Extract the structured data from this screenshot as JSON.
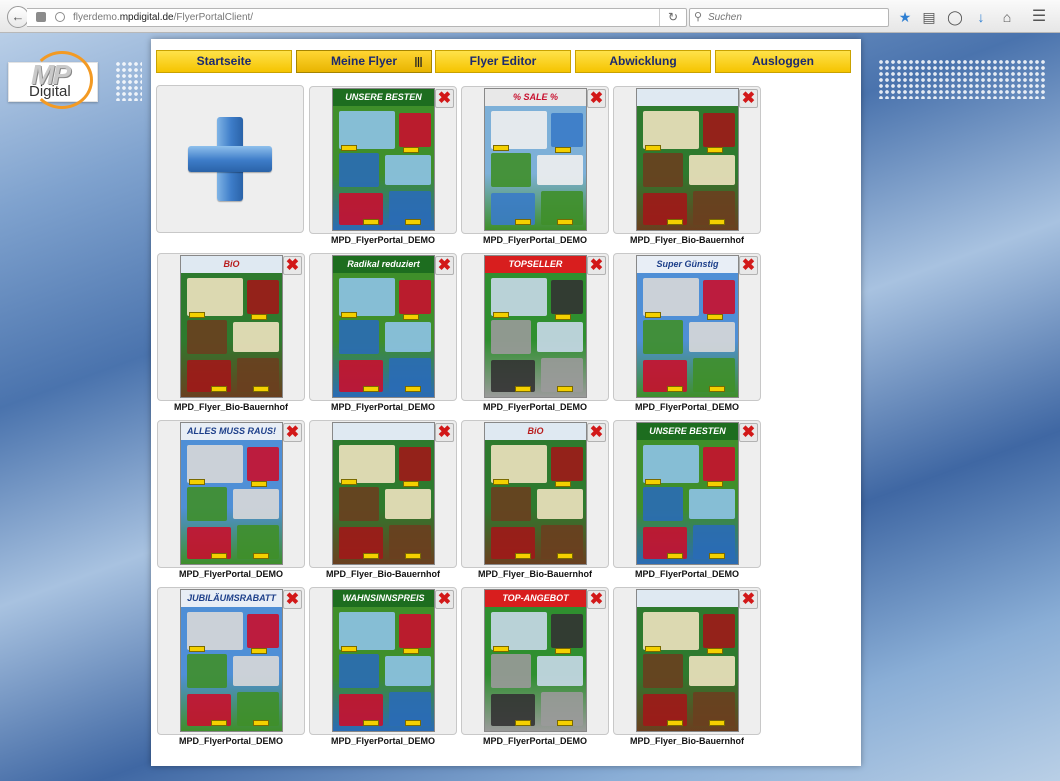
{
  "browser": {
    "back_icon": "arrow-left-icon",
    "url_prefix": "flyerdemo.",
    "url_domain": "mpdigital.de",
    "url_path": "/FlyerPortalClient/",
    "reload_icon": "reload-icon",
    "search_placeholder": "Suchen",
    "search_icon": "magnifier-icon",
    "toolbar_icons": [
      "star-icon",
      "reading-list-icon",
      "pocket-icon",
      "download-icon",
      "home-icon",
      "hamburger-menu-icon"
    ]
  },
  "logo": {
    "mp": "MP",
    "digital": "Digital",
    "accent_color": "#f39a23"
  },
  "menu": {
    "items": [
      {
        "label": "Startseite",
        "active": false
      },
      {
        "label": "Meine Flyer",
        "active": true
      },
      {
        "label": "Flyer Editor",
        "active": false
      },
      {
        "label": "Abwicklung",
        "active": false
      },
      {
        "label": "Ausloggen",
        "active": false
      }
    ],
    "button_color": "#f5c400",
    "text_color": "#1c2a6e"
  },
  "add_card": {
    "icon": "plus-icon"
  },
  "delete_icon": "close-x-icon",
  "flyers": [
    {
      "caption": "MPD_FlyerPortal_DEMO",
      "banner": "UNSERE BESTEN",
      "theme": "demo-green"
    },
    {
      "caption": "MPD_FlyerPortal_DEMO",
      "banner": "% SALE %",
      "theme": "demo-sale"
    },
    {
      "caption": "MPD_Flyer_Bio-Bauernhof",
      "banner": "",
      "theme": "bio"
    },
    {
      "caption": "MPD_Flyer_Bio-Bauernhof",
      "banner": "BiO",
      "theme": "bio"
    },
    {
      "caption": "MPD_FlyerPortal_DEMO",
      "banner": "Radikal reduziert",
      "theme": "demo-green"
    },
    {
      "caption": "MPD_FlyerPortal_DEMO",
      "banner": "TOPSELLER",
      "theme": "demo-top"
    },
    {
      "caption": "MPD_FlyerPortal_DEMO",
      "banner": "Super Günstig",
      "theme": "demo-blue"
    },
    {
      "caption": "MPD_FlyerPortal_DEMO",
      "banner": "ALLES MUSS RAUS!",
      "theme": "demo-blue"
    },
    {
      "caption": "MPD_Flyer_Bio-Bauernhof",
      "banner": "",
      "theme": "bio"
    },
    {
      "caption": "MPD_Flyer_Bio-Bauernhof",
      "banner": "BiO",
      "theme": "bio"
    },
    {
      "caption": "MPD_FlyerPortal_DEMO",
      "banner": "UNSERE BESTEN",
      "theme": "demo-green"
    },
    {
      "caption": "MPD_FlyerPortal_DEMO",
      "banner": "JUBILÄUMSRABATT",
      "theme": "demo-blue"
    },
    {
      "caption": "MPD_FlyerPortal_DEMO",
      "banner": "WAHNSINNSPREIS",
      "theme": "demo-green"
    },
    {
      "caption": "MPD_FlyerPortal_DEMO",
      "banner": "TOP-ANGEBOT",
      "theme": "demo-top"
    },
    {
      "caption": "MPD_Flyer_Bio-Bauernhof",
      "banner": "",
      "theme": "bio"
    }
  ]
}
